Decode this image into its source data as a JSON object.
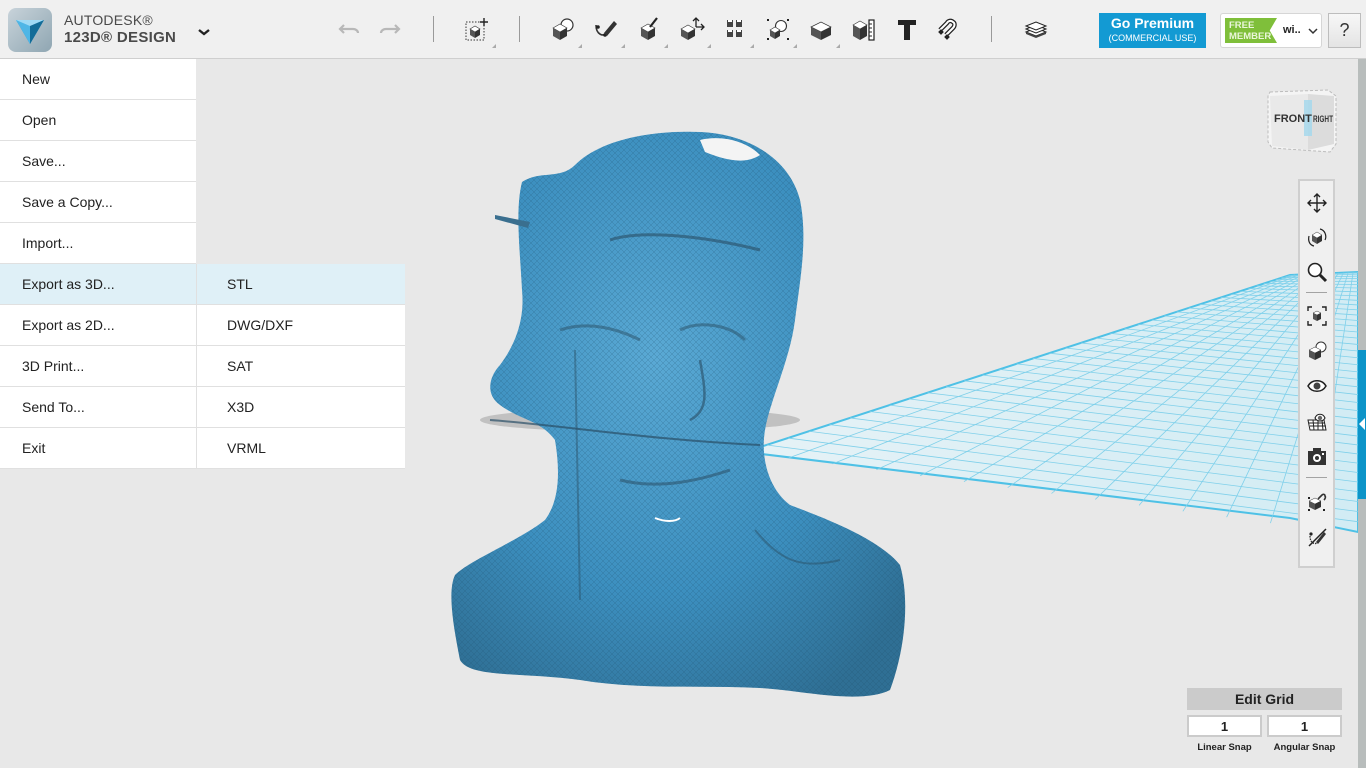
{
  "app": {
    "brand_line1": "AUTODESK®",
    "brand_line2": "123D® DESIGN",
    "logo_icon": "123d-design-logo-icon",
    "menu_toggle_icon": "chevron-down-icon"
  },
  "toolbar": {
    "undo_icon": "undo-icon",
    "redo_icon": "redo-icon",
    "tools": [
      {
        "name": "transform",
        "icon": "transform-icon"
      },
      {
        "name": "primitives",
        "icon": "primitives-icon"
      },
      {
        "name": "sketch",
        "icon": "sketch-icon"
      },
      {
        "name": "construct",
        "icon": "construct-icon"
      },
      {
        "name": "modify",
        "icon": "modify-icon"
      },
      {
        "name": "pattern",
        "icon": "pattern-icon"
      },
      {
        "name": "grouping",
        "icon": "grouping-icon"
      },
      {
        "name": "combine",
        "icon": "combine-icon"
      },
      {
        "name": "measure",
        "icon": "measure-icon"
      },
      {
        "name": "text",
        "icon": "text-icon"
      },
      {
        "name": "snap",
        "icon": "magnet-icon"
      },
      {
        "name": "material",
        "icon": "material-layers-icon"
      }
    ],
    "premium_title": "Go Premium",
    "premium_subtitle": "(COMMERCIAL USE)",
    "member_badge": "FREE MEMBER",
    "member_badge_line1": "FREE",
    "member_badge_line2": "MEMBER",
    "username": "wi..",
    "help_label": "?"
  },
  "file_menu": {
    "items": [
      {
        "label": "New"
      },
      {
        "label": "Open"
      },
      {
        "label": "Save..."
      },
      {
        "label": "Save a Copy..."
      },
      {
        "label": "Import..."
      },
      {
        "label": "Export as 3D...",
        "active": true
      },
      {
        "label": "Export as 2D..."
      },
      {
        "label": "3D Print..."
      },
      {
        "label": "Send To..."
      },
      {
        "label": "Exit"
      }
    ],
    "submenu": {
      "parent": "Export as 3D...",
      "items": [
        {
          "label": "STL",
          "active": true
        },
        {
          "label": "DWG/DXF"
        },
        {
          "label": "SAT"
        },
        {
          "label": "X3D"
        },
        {
          "label": "VRML"
        }
      ]
    }
  },
  "viewcube": {
    "front_label": "FRONT",
    "right_label": "RIGHT"
  },
  "navbar": {
    "items": [
      {
        "name": "pan",
        "icon": "pan-icon"
      },
      {
        "name": "orbit",
        "icon": "orbit-icon"
      },
      {
        "name": "zoom",
        "icon": "zoom-icon"
      },
      {
        "name": "fit",
        "icon": "fit-view-icon"
      },
      {
        "name": "materials-outlines",
        "icon": "materials-outlines-icon"
      },
      {
        "name": "visibility",
        "icon": "eye-icon"
      },
      {
        "name": "grid-visibility",
        "icon": "grid-eye-icon"
      },
      {
        "name": "screenshot",
        "icon": "camera-icon"
      },
      {
        "name": "snap-objects",
        "icon": "snap-object-icon"
      },
      {
        "name": "hide-sketches",
        "icon": "hide-sketch-icon"
      }
    ]
  },
  "edit_grid": {
    "title": "Edit Grid",
    "linear_snap_value": "1",
    "angular_snap_value": "1",
    "linear_snap_label": "Linear Snap",
    "angular_snap_label": "Angular Snap"
  },
  "colors": {
    "accent": "#139ad3",
    "model": "#3f93c2",
    "grid": "#4ec1e6",
    "menu_highlight": "#dff0f7",
    "member_green": "#7fbf3a"
  }
}
